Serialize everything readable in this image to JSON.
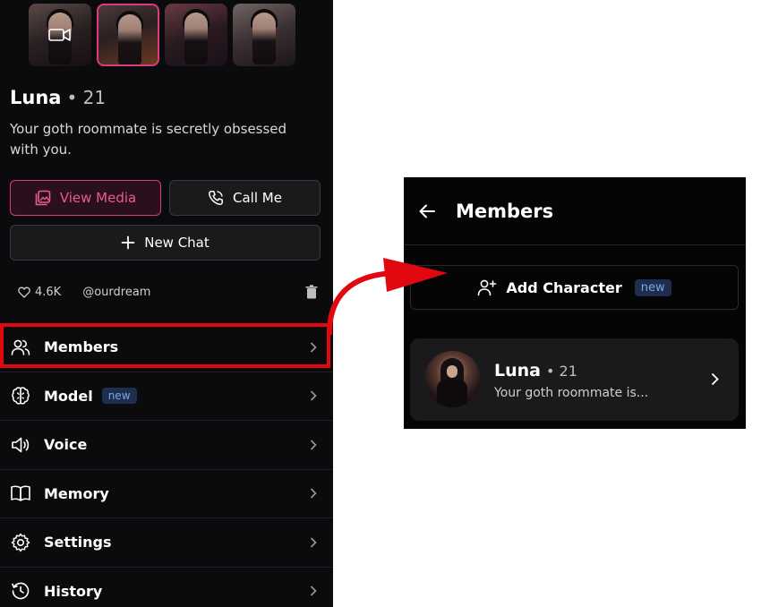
{
  "profile": {
    "name": "Luna",
    "age": "• 21",
    "bio": "Your goth roommate is secretly obsessed with you.",
    "likes": "4.6K",
    "handle": "@ourdream"
  },
  "buttons": {
    "view_media": "View Media",
    "call_me": "Call Me",
    "new_chat": "New Chat"
  },
  "menu": {
    "items": [
      {
        "label": "Members",
        "icon": "users-icon"
      },
      {
        "label": "Model",
        "icon": "brain-icon",
        "badge": "new"
      },
      {
        "label": "Voice",
        "icon": "speaker-icon"
      },
      {
        "label": "Memory",
        "icon": "book-icon"
      },
      {
        "label": "Settings",
        "icon": "gear-icon"
      },
      {
        "label": "History",
        "icon": "history-icon"
      }
    ]
  },
  "members_panel": {
    "title": "Members",
    "add_character": "Add Character",
    "add_badge": "new",
    "member": {
      "name": "Luna",
      "age": "• 21",
      "subtitle": "Your goth roommate is..."
    }
  },
  "colors": {
    "accent_pink": "#e0387e",
    "highlight_red": "#e2080f",
    "badge_blue": "#7ea6ea"
  }
}
